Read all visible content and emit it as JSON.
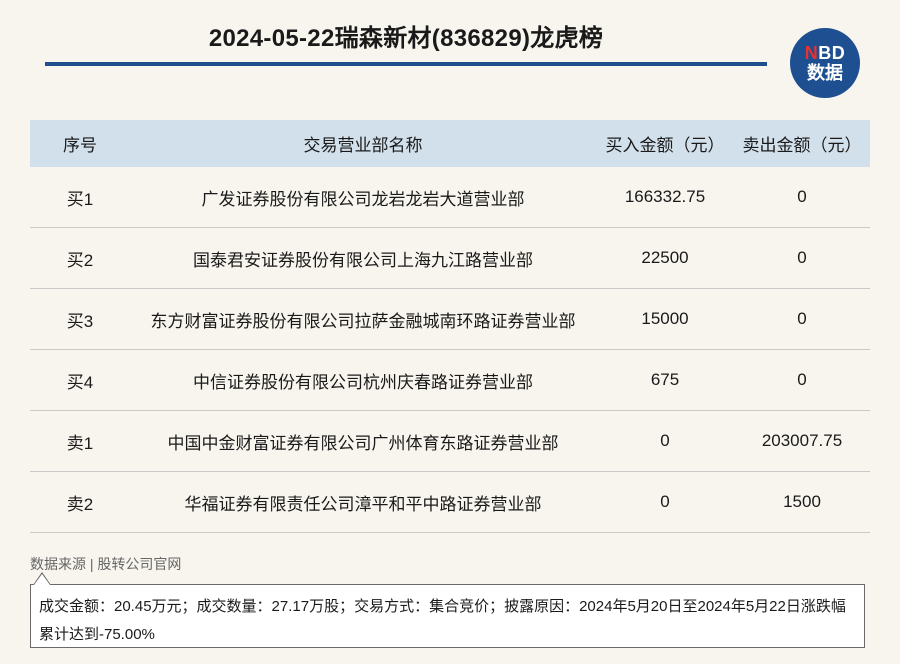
{
  "header": {
    "title": "2024-05-22瑞森新材(836829)龙虎榜",
    "logo_line1_prefix": "N",
    "logo_line1_rest": "BD",
    "logo_line2": "数据"
  },
  "table": {
    "columns": [
      "序号",
      "交易营业部名称",
      "买入金额（元）",
      "卖出金额（元）"
    ],
    "rows": [
      {
        "seq": "买1",
        "name": "广发证券股份有限公司龙岩龙岩大道营业部",
        "buy": "166332.75",
        "sell": "0"
      },
      {
        "seq": "买2",
        "name": "国泰君安证券股份有限公司上海九江路营业部",
        "buy": "22500",
        "sell": "0"
      },
      {
        "seq": "买3",
        "name": "东方财富证券股份有限公司拉萨金融城南环路证券营业部",
        "buy": "15000",
        "sell": "0"
      },
      {
        "seq": "买4",
        "name": "中信证券股份有限公司杭州庆春路证券营业部",
        "buy": "675",
        "sell": "0"
      },
      {
        "seq": "卖1",
        "name": "中国中金财富证券有限公司广州体育东路证券营业部",
        "buy": "0",
        "sell": "203007.75"
      },
      {
        "seq": "卖2",
        "name": "华福证券有限责任公司漳平和平中路证券营业部",
        "buy": "0",
        "sell": "1500"
      }
    ]
  },
  "footer": {
    "source": "数据来源 | 股转公司官网",
    "note": "成交金额：20.45万元；成交数量：27.17万股；交易方式：集合竞价；披露原因：2024年5月20日至2024年5月22日涨跌幅累计达到-75.00%"
  },
  "colors": {
    "accent": "#1f4e8c",
    "header_bg": "#d2e0ec",
    "page_bg": "#f8f5ee",
    "logo_red": "#e8322f"
  }
}
